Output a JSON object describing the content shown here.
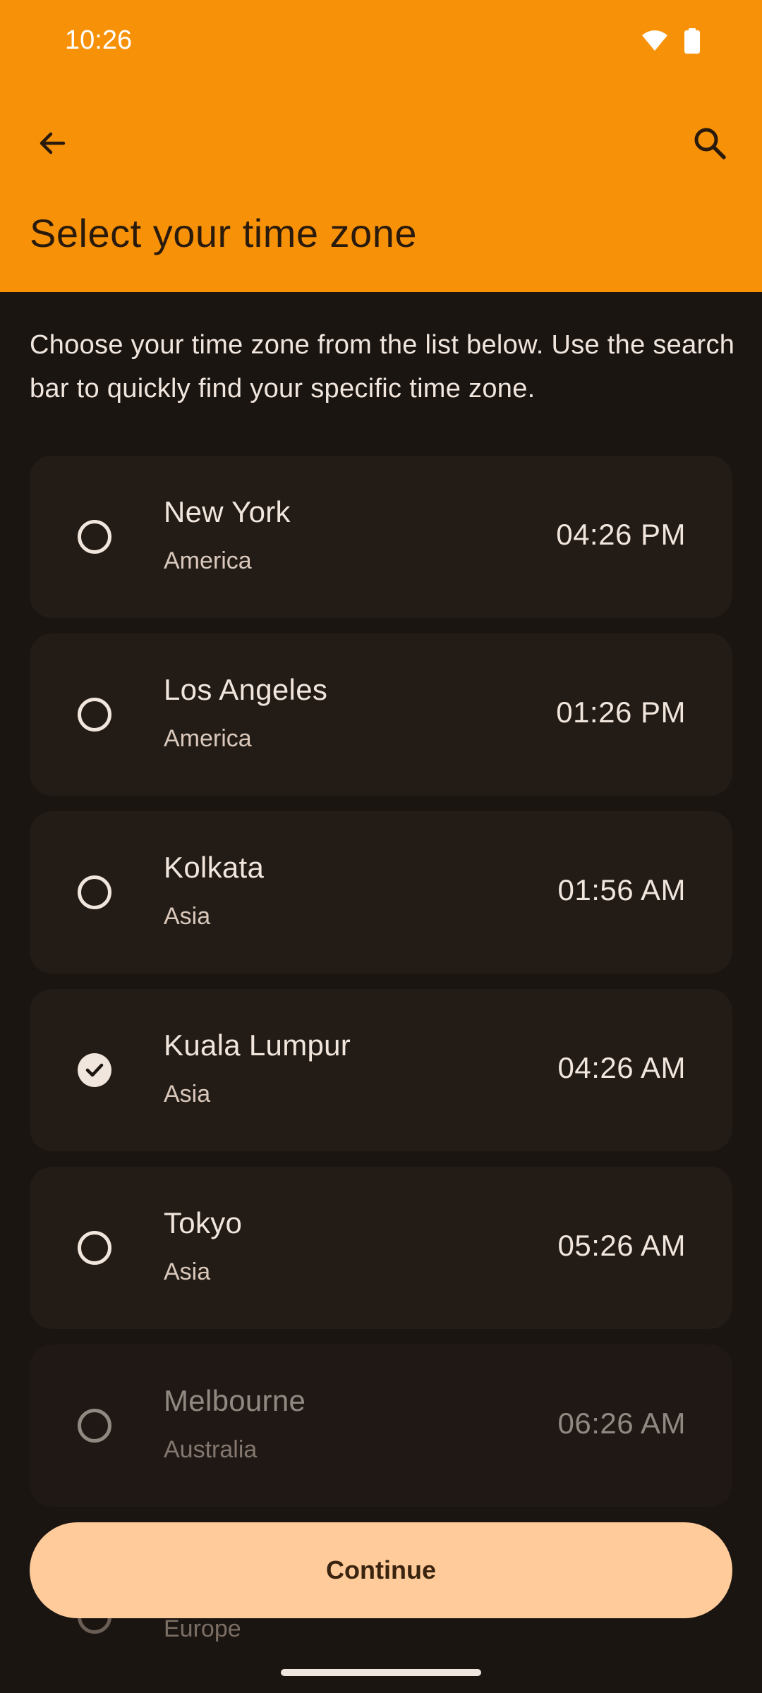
{
  "status_bar": {
    "time": "10:26",
    "icons": [
      "wifi-icon",
      "battery-icon"
    ]
  },
  "header": {
    "back_icon": "arrow-left-icon",
    "search_icon": "search-icon",
    "title": "Select your time zone"
  },
  "description": "Choose your time zone from the list below. Use the search bar to quickly find your specific time zone.",
  "timezones": [
    {
      "city": "New York",
      "region": "America",
      "time": "04:26 PM",
      "selected": false
    },
    {
      "city": "Los Angeles",
      "region": "America",
      "time": "01:26 PM",
      "selected": false
    },
    {
      "city": "Kolkata",
      "region": "Asia",
      "time": "01:56 AM",
      "selected": false
    },
    {
      "city": "Kuala Lumpur",
      "region": "Asia",
      "time": "04:26 AM",
      "selected": true
    },
    {
      "city": "Tokyo",
      "region": "Asia",
      "time": "05:26 AM",
      "selected": false
    },
    {
      "city": "Melbourne",
      "region": "Australia",
      "time": "06:26 AM",
      "selected": false
    }
  ],
  "partial_item": {
    "region": "Europe"
  },
  "continue_label": "Continue",
  "colors": {
    "header_bg": "#f79208",
    "screen_bg": "#1b1512",
    "card_bg": "#231c16",
    "button_bg": "#ffcb9a",
    "text_light": "#f1e6dd"
  }
}
